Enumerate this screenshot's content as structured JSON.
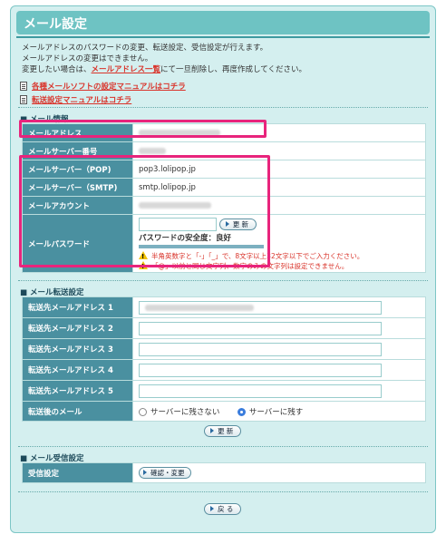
{
  "page": {
    "title": "メール設定",
    "description": [
      "メールアドレスのパスワードの変更、転送設定、受信設定が行えます。",
      "メールアドレスの変更はできません。"
    ],
    "description_line3_prefix": "変更したい場合は、",
    "description_link": "メールアドレス一覧",
    "description_line3_suffix": "にて一旦削除し、再度作成してください。",
    "manual_links": [
      "各種メールソフトの設定マニュアルはコチラ",
      "転送設定マニュアルはコチラ"
    ]
  },
  "mail_info": {
    "heading": "メール情報",
    "rows": {
      "address_label": "メールアドレス",
      "server_number_label": "メールサーバー番号",
      "pop_label": "メールサーバー（POP)",
      "pop_value": "pop3.lolipop.jp",
      "smtp_label": "メールサーバー（SMTP)",
      "smtp_value": "smtp.lolipop.jp",
      "account_label": "メールアカウント",
      "password_label": "メールパスワード"
    },
    "update_button": "更 新",
    "strength_label": "パスワードの安全度：良好",
    "warnings": [
      "半角英数字と「-」「_」で、8文字以上32文字以下でご入力ください。",
      "「@」以前と同じ文字列、数字のみの文字列は設定できません。"
    ]
  },
  "forwarding": {
    "heading": "メール転送設定",
    "fields": [
      "転送先メールアドレス 1",
      "転送先メールアドレス 2",
      "転送先メールアドレス 3",
      "転送先メールアドレス 4",
      "転送先メールアドレス 5"
    ],
    "after_label": "転送後のメール",
    "option_no": "サーバーに残さない",
    "option_yes": "サーバーに残す",
    "selected": "サーバーに残す",
    "update_button": "更 新"
  },
  "receiving": {
    "heading": "メール受信設定",
    "label": "受信設定",
    "button": "確認・変更"
  },
  "back_button": "戻 る"
}
